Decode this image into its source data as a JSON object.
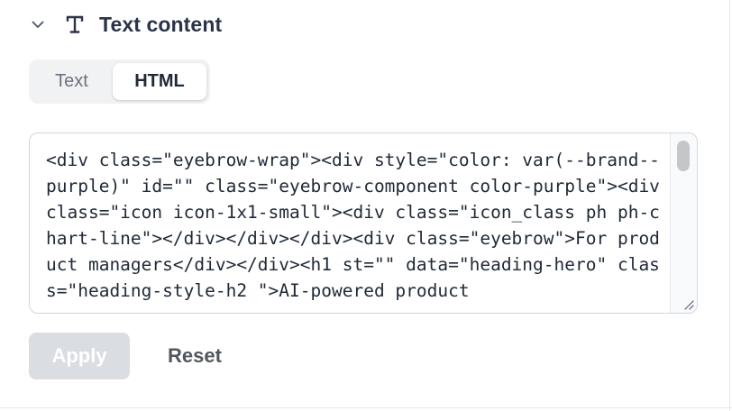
{
  "section": {
    "title": "Text content",
    "chevron_icon": "chevron-down-icon",
    "type_icon": "text-type-icon"
  },
  "mode_toggle": {
    "options": [
      "Text",
      "HTML"
    ],
    "selected": "HTML"
  },
  "editor": {
    "value": "<div class=\"eyebrow-wrap\"><div style=\"color: var(--brand--purple)\" id=\"\" class=\"eyebrow-component color-purple\"><div class=\"icon icon-1x1-small\"><div class=\"icon_class ph ph-chart-line\"></div></div></div><div class=\"eyebrow\">For product managers</div></div><h1 st=\"\" data=\"heading-hero\" class=\"heading-style-h2 \">AI-powered product"
  },
  "actions": {
    "apply_label": "Apply",
    "apply_disabled": true,
    "reset_label": "Reset"
  },
  "colors": {
    "title": "#2b3349",
    "toggle_bg": "#f1f2f4",
    "disabled_button_bg": "#dadde2",
    "border": "#d1d5db"
  }
}
